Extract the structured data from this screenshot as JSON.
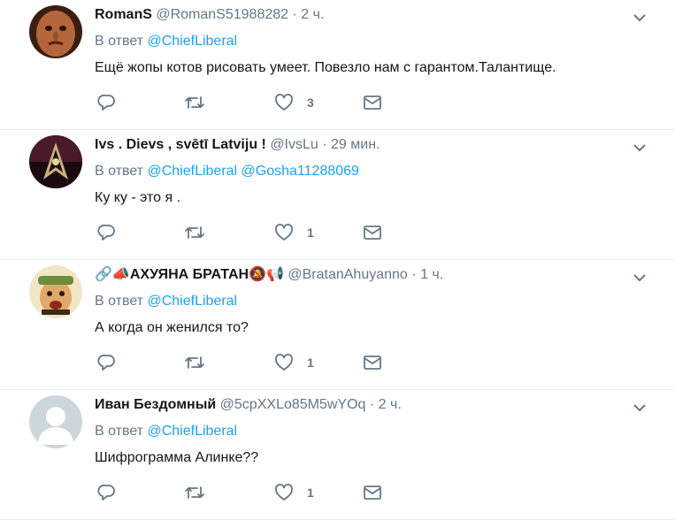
{
  "tweets": [
    {
      "name": "RomanS",
      "handle": "@RomanS51988282",
      "dot": "·",
      "time": "2 ч.",
      "reply_prefix": "В ответ",
      "mentions": [
        "@ChiefLiberal"
      ],
      "text": "Ещё жопы котов рисовать умеет. Повезло нам с гарантом.Талантище.",
      "likes": "3"
    },
    {
      "name": "Ivs . Dievs , svētī Latviju !",
      "handle": "@IvsLu",
      "dot": "·",
      "time": "29 мин.",
      "reply_prefix": "В ответ",
      "mentions": [
        "@ChiefLiberal",
        "@Gosha11288069"
      ],
      "text": "Ку ку - это я .",
      "likes": "1"
    },
    {
      "name_prefix_emoji": "🔗📣",
      "name": "АХУЯНА БРАТАН",
      "name_suffix_emoji": "🔕📢",
      "handle": "@BratanAhuyanno",
      "dot": "·",
      "time": "1 ч.",
      "reply_prefix": "В ответ",
      "mentions": [
        "@ChiefLiberal"
      ],
      "text": "А когда он женился то?",
      "likes": "1"
    },
    {
      "name": "Иван Бездомный",
      "handle": "@5cpXXLo85M5wYOq",
      "dot": "·",
      "time": "2 ч.",
      "reply_prefix": "В ответ",
      "mentions": [
        "@ChiefLiberal"
      ],
      "text": "Шифрограмма Алинке??",
      "likes": "1"
    }
  ],
  "colors": {
    "accent": "#1da1f2",
    "muted": "#657786",
    "divider": "#e6ecf0"
  },
  "icons": [
    "reply-icon",
    "retweet-icon",
    "like-icon",
    "direct-message-icon",
    "chevron-down-icon"
  ]
}
